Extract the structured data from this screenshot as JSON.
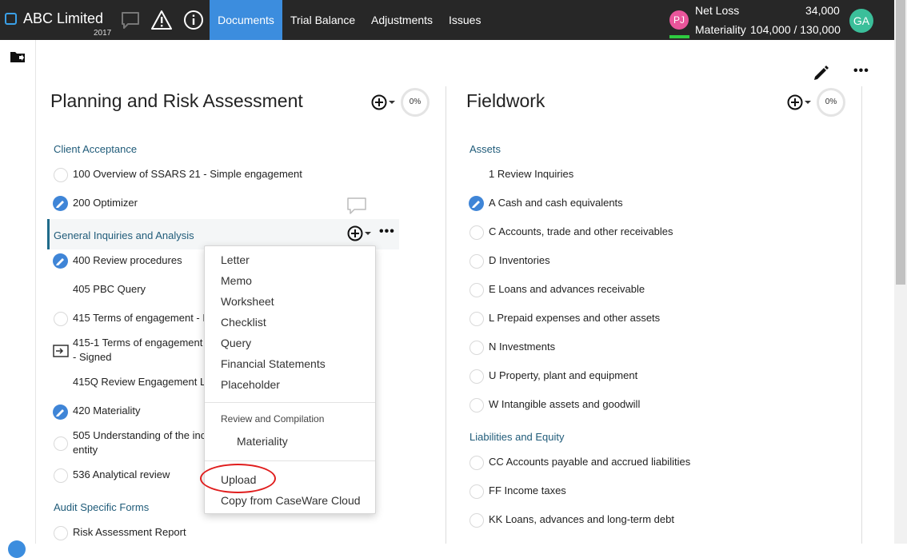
{
  "app": {
    "company": "ABC Limited",
    "year": "2017"
  },
  "nav": {
    "tabs": [
      "Documents",
      "Trial Balance",
      "Adjustments",
      "Issues"
    ]
  },
  "stats": {
    "net_loss_label": "Net Loss",
    "net_loss_value": "34,000",
    "materiality_label": "Materiality",
    "materiality_value": "104,000 / 130,000"
  },
  "users": {
    "current_initials": "PJ",
    "other_initials": "GA"
  },
  "left_column": {
    "title": "Planning and Risk Assessment",
    "progress": "0%",
    "groups": [
      {
        "label": "Client Acceptance"
      },
      {
        "label": "General Inquiries and Analysis"
      },
      {
        "label": "Audit Specific Forms"
      }
    ],
    "items": [
      "100 Overview of SSARS 21 - Simple engagement",
      "200 Optimizer",
      "400 Review procedures",
      "405 PBC Query",
      "415 Terms of engagement - E",
      "415-1 Terms of engagement",
      "- Signed",
      "415Q Review Engagement Le",
      "420 Materiality",
      "505 Understanding of the inc",
      "entity",
      "536 Analytical review",
      "Risk Assessment Report"
    ]
  },
  "right_column": {
    "title": "Fieldwork",
    "progress": "0%",
    "groups": [
      {
        "label": "Assets"
      },
      {
        "label": "Liabilities and Equity"
      }
    ],
    "items": [
      "1 Review Inquiries",
      "A Cash and cash equivalents",
      "C Accounts, trade and other receivables",
      "D Inventories",
      "E Loans and advances receivable",
      "L Prepaid expenses and other assets",
      "N Investments",
      "U Property, plant and equipment",
      "W Intangible assets and goodwill",
      "CC Accounts payable and accrued liabilities",
      "FF Income taxes",
      "KK Loans, advances and long-term debt"
    ]
  },
  "menu": {
    "items": [
      "Letter",
      "Memo",
      "Worksheet",
      "Checklist",
      "Query",
      "Financial Statements",
      "Placeholder"
    ],
    "section_header": "Review and Compilation",
    "section_item": "Materiality",
    "upload": "Upload",
    "copy_cloud": "Copy from CaseWare Cloud"
  },
  "colors": {
    "accent": "#3c8dde",
    "topbar": "#272727",
    "group_text": "#1f5b79",
    "highlight": "#e01e1e"
  },
  "icons": [
    "folder-icon",
    "comment-icon",
    "warning-icon",
    "info-icon",
    "edit-icon",
    "more-icon",
    "add-icon",
    "signed-icon",
    "check-pencil-icon"
  ]
}
